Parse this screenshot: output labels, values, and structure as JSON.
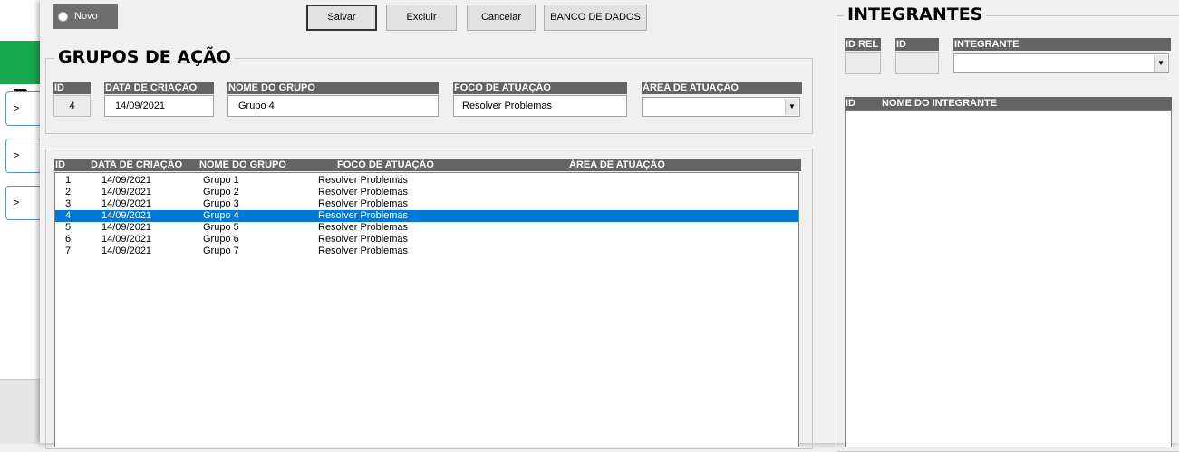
{
  "background_app": {
    "nav_buttons": [
      ">",
      ">",
      ">"
    ],
    "accent_color": "#17a84b"
  },
  "toolbar": {
    "novo_label": "Novo",
    "save_label": "Salvar",
    "delete_label": "Excluir",
    "cancel_label": "Cancelar",
    "database_label": "BANCO DE DADOS"
  },
  "groups_frame": {
    "title": "GRUPOS DE AÇÃO",
    "fields": {
      "id": {
        "label": "ID",
        "value": "4"
      },
      "creation_date": {
        "label": "DATA DE CRIAÇÃO",
        "value": "14/09/2021"
      },
      "group_name": {
        "label": "NOME DO GRUPO",
        "value": "Grupo 4"
      },
      "focus": {
        "label": "FOCO DE ATUAÇÃO",
        "value": "Resolver Problemas"
      },
      "area": {
        "label": "ÁREA DE ATUAÇÃO",
        "value": ""
      }
    }
  },
  "groups_list": {
    "columns": [
      "ID",
      "DATA DE CRIAÇÃO",
      "NOME DO GRUPO",
      "FOCO DE ATUAÇÃO",
      "ÁREA DE ATUAÇÃO"
    ],
    "selected_index": 3,
    "selection_color": "#0078d7",
    "rows": [
      {
        "id": "1",
        "date": "14/09/2021",
        "name": "Grupo 1",
        "focus": "Resolver Problemas",
        "area": ""
      },
      {
        "id": "2",
        "date": "14/09/2021",
        "name": "Grupo 2",
        "focus": "Resolver Problemas",
        "area": ""
      },
      {
        "id": "3",
        "date": "14/09/2021",
        "name": "Grupo 3",
        "focus": "Resolver Problemas",
        "area": ""
      },
      {
        "id": "4",
        "date": "14/09/2021",
        "name": "Grupo 4",
        "focus": "Resolver Problemas",
        "area": ""
      },
      {
        "id": "5",
        "date": "14/09/2021",
        "name": "Grupo 5",
        "focus": "Resolver Problemas",
        "area": ""
      },
      {
        "id": "6",
        "date": "14/09/2021",
        "name": "Grupo 6",
        "focus": "Resolver Problemas",
        "area": ""
      },
      {
        "id": "7",
        "date": "14/09/2021",
        "name": "Grupo 7",
        "focus": "Resolver Problemas",
        "area": ""
      }
    ]
  },
  "members_frame": {
    "title": "INTEGRANTES",
    "fields": {
      "id_rel": {
        "label": "ID REL",
        "value": ""
      },
      "id": {
        "label": "ID",
        "value": ""
      },
      "member": {
        "label": "INTEGRANTE",
        "value": ""
      }
    },
    "list_columns": [
      "ID",
      "NOME DO INTEGRANTE"
    ],
    "rows": []
  }
}
